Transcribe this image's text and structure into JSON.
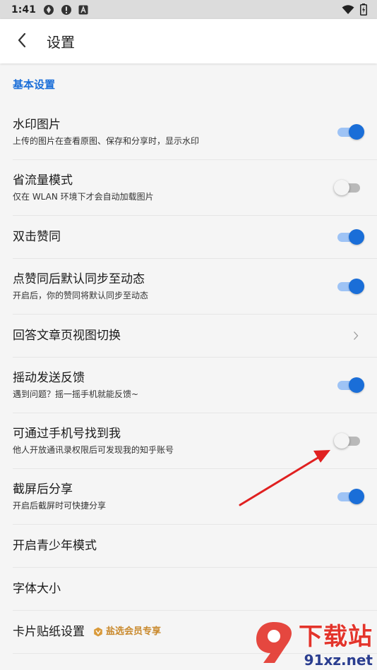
{
  "status_bar": {
    "time": "1:41",
    "left_icons": [
      "sync-icon",
      "alert-icon",
      "a-letter-icon"
    ],
    "right_icons": [
      "wifi-icon",
      "battery-icon"
    ]
  },
  "header": {
    "title": "设置",
    "back_icon": "chevron-left-icon"
  },
  "section": {
    "title": "基本设置"
  },
  "settings": [
    {
      "title": "水印图片",
      "subtitle": "上传的图片在查看原图、保存和分享时，显示水印",
      "control": "toggle",
      "on": true
    },
    {
      "title": "省流量模式",
      "subtitle": "仅在 WLAN 环境下才会自动加载图片",
      "control": "toggle",
      "on": false
    },
    {
      "title": "双击赞同",
      "subtitle": "",
      "control": "toggle",
      "on": true
    },
    {
      "title": "点赞同后默认同步至动态",
      "subtitle": "开启后，你的赞同将默认同步至动态",
      "control": "toggle",
      "on": true
    },
    {
      "title": "回答文章页视图切换",
      "subtitle": "",
      "control": "chevron"
    },
    {
      "title": "摇动发送反馈",
      "subtitle": "遇到问题？摇一摇手机就能反馈~",
      "control": "toggle",
      "on": true
    },
    {
      "title": "可通过手机号找到我",
      "subtitle": "他人开放通讯录权限后可发现我的知乎账号",
      "control": "toggle",
      "on": false
    },
    {
      "title": "截屏后分享",
      "subtitle": "开启后截屏时可快捷分享",
      "control": "toggle",
      "on": true
    },
    {
      "title": "开启青少年模式",
      "subtitle": "",
      "control": "none"
    },
    {
      "title": "字体大小",
      "subtitle": "",
      "control": "none"
    },
    {
      "title": "卡片贴纸设置",
      "subtitle": "",
      "control": "none",
      "badge": "盐选会员专享"
    }
  ],
  "colors": {
    "accent": "#1a6ed8",
    "toggle_track_on": "#9ec3f5",
    "toggle_off": "#b9b9b9",
    "annotation_arrow": "#e02020",
    "badge": "#c9892c"
  },
  "watermark": {
    "cn": "下载站",
    "en": "91xz.net"
  }
}
